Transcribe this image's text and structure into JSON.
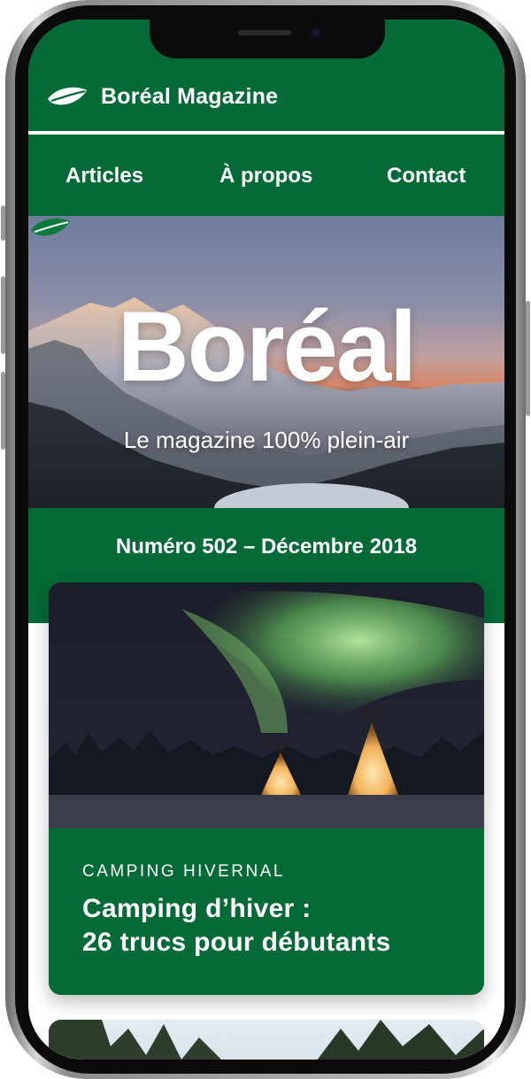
{
  "header": {
    "brand_name": "Boréal Magazine",
    "logo_icon": "leaf-icon"
  },
  "nav": {
    "items": [
      {
        "label": "Articles"
      },
      {
        "label": "À propos"
      },
      {
        "label": "Contact"
      }
    ]
  },
  "hero": {
    "title": "Boréal",
    "subtitle": "Le magazine 100% plein-air"
  },
  "issue": {
    "label": "Numéro 502 – Décembre 2018"
  },
  "articles": [
    {
      "category": "CAMPING HIVERNAL",
      "title_line1": "Camping d’hiver :",
      "title_line2": "26 trucs pour débutants"
    }
  ],
  "colors": {
    "brand_green": "#046a36",
    "white": "#ffffff"
  }
}
